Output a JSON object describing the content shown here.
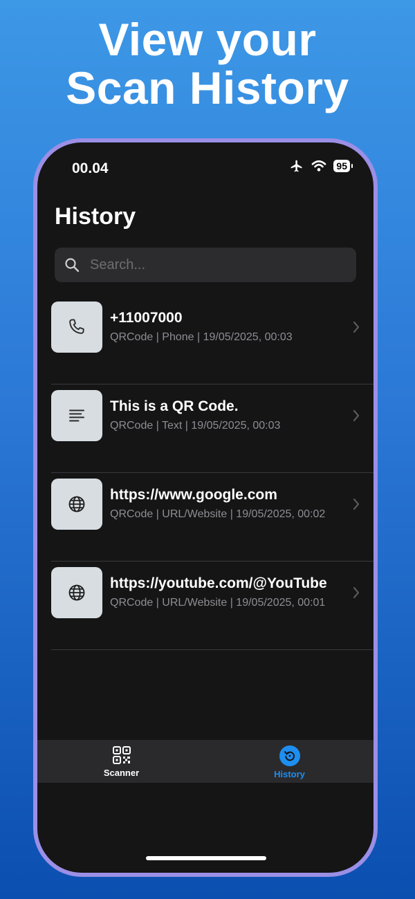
{
  "promo": {
    "title_line1": "View your",
    "title_line2": "Scan History"
  },
  "status_bar": {
    "time": "00.04",
    "battery": "95",
    "icons": [
      "airplane-icon",
      "wifi-icon",
      "battery-icon"
    ]
  },
  "header": {
    "title": "History"
  },
  "search": {
    "placeholder": "Search...",
    "value": ""
  },
  "history": {
    "items": [
      {
        "icon": "phone-icon",
        "title": "+11007000",
        "subtitle": "QRCode | Phone | 19/05/2025, 00:03"
      },
      {
        "icon": "text-lines-icon",
        "title": "This is a QR Code.",
        "subtitle": "QRCode | Text | 19/05/2025, 00:03"
      },
      {
        "icon": "globe-icon",
        "title": "https://www.google.com",
        "subtitle": "QRCode | URL/Website | 19/05/2025, 00:02"
      },
      {
        "icon": "globe-icon",
        "title": "https://youtube.com/@YouTube",
        "subtitle": "QRCode | URL/Website | 19/05/2025, 00:01"
      }
    ]
  },
  "tab_bar": {
    "tabs": [
      {
        "label": "Scanner",
        "icon": "qr-code-icon",
        "active": false
      },
      {
        "label": "History",
        "icon": "history-icon",
        "active": true
      }
    ]
  },
  "colors": {
    "accent": "#1e8ef0",
    "screen_background": "#151516",
    "frame": "#9b8fe6"
  }
}
